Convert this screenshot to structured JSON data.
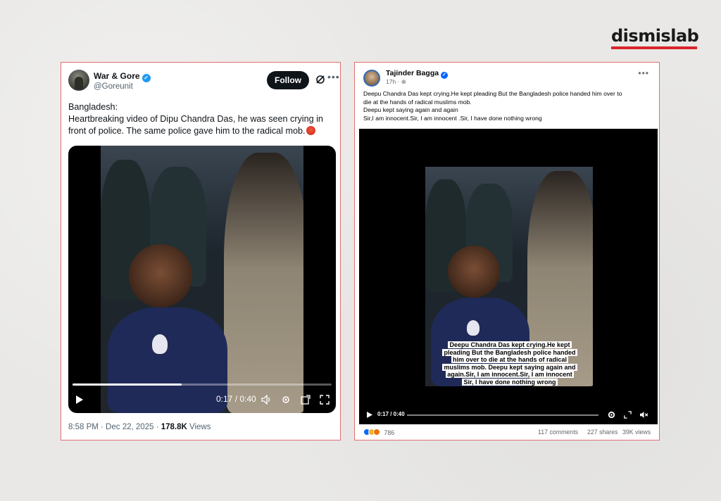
{
  "logo": {
    "text": "dismislab"
  },
  "left_post": {
    "author_name": "War & Gore",
    "author_handle": "@Goreunit",
    "follow_label": "Follow",
    "text_line1": "Bangladesh:",
    "text_body": "Heartbreaking video of Dipu Chandra Das, he was seen crying in front of police. The same police gave him to the radical mob.",
    "video": {
      "time": "0:17 / 0:40",
      "progress": 0.42
    },
    "timestamp": "8:58 PM · Dec 22, 2025 · ",
    "views_count": "178.8K",
    "views_label": " Views"
  },
  "right_post": {
    "author_name": "Tajinder Bagga",
    "time": "17h · ",
    "text_lines": [
      "Deepu Chandra Das kept crying.He kept pleading  But the Bangladesh police handed him over to",
      "die at the hands of radical muslims mob.",
      "Deepu kept saying again and again",
      "Sir,I am innocent.Sir, I am innocent .Sir, I have done nothing wrong"
    ],
    "caption_lines": [
      "Deepu Chandra Das kept crying.He kept",
      "pleading  But the Bangladesh police handed",
      "him over to die at the hands of radical",
      "muslims mob.  Deepu kept saying again and",
      "again.Sir, I am innocent.Sir, I am innocent",
      "Sir, I have done nothing wrong"
    ],
    "video": {
      "time": "0:17 / 0:40",
      "progress": 0.0
    },
    "reactions_count": "786",
    "comments": "117 comments",
    "shares": "227 shares",
    "views": "39K views"
  },
  "colors": {
    "panel_border": "#e07070",
    "brand_red": "#d9252b",
    "twitter_blue": "#1d9bf0"
  }
}
